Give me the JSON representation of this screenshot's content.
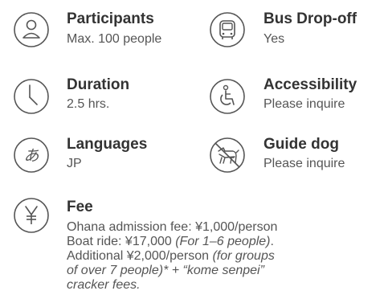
{
  "items": [
    {
      "title": "Participants",
      "value": "Max. 100 people",
      "icon": "person-icon"
    },
    {
      "title": "Bus Drop-off",
      "value": "Yes",
      "icon": "bus-icon"
    },
    {
      "title": "Duration",
      "value": "2.5 hrs.",
      "icon": "clock-icon"
    },
    {
      "title": "Accessibility",
      "value": "Please inquire",
      "icon": "wheelchair-icon"
    },
    {
      "title": "Languages",
      "value": "JP",
      "icon": "language-icon"
    },
    {
      "title": "Guide dog",
      "value": "Please inquire",
      "icon": "guide-dog-icon"
    }
  ],
  "fee": {
    "icon": "yen-icon",
    "title": "Fee",
    "line1": "Ohana admission fee: ¥1,000/person",
    "line2_main": "Boat ride: ¥17,000 ",
    "line2_italic": "(For 1–6 people)",
    "line2_end": ".",
    "line3_main": "Additional ¥2,000/person ",
    "line3_italic": "(for groups",
    "line4": "of over 7 people)* + “kome senpei”",
    "line5": "cracker fees."
  }
}
